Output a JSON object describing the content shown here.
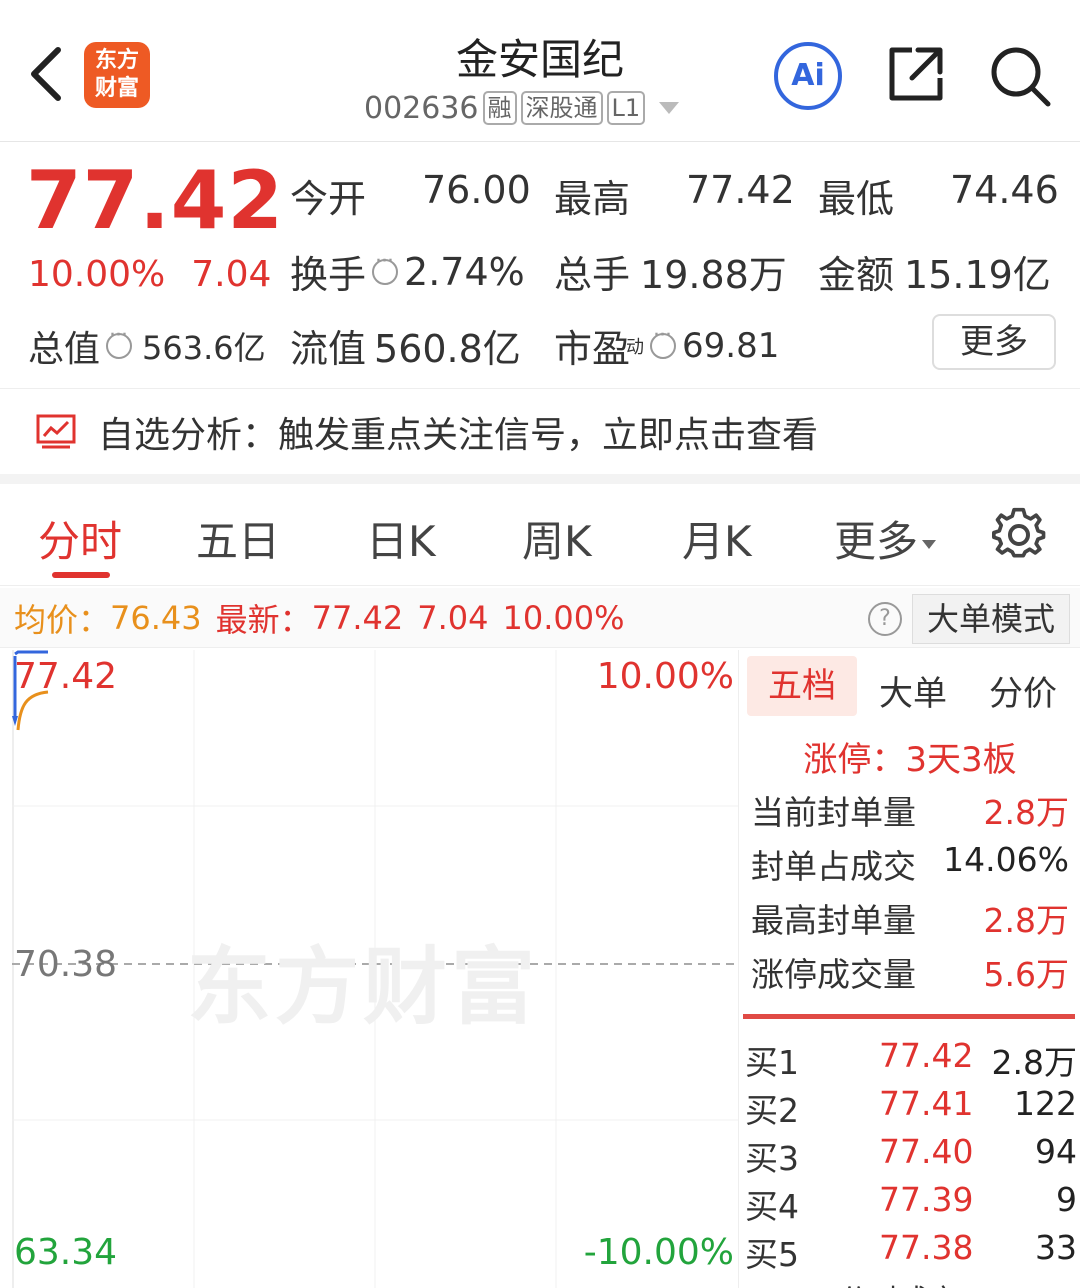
{
  "header": {
    "stock_name": "金安国纪",
    "stock_code": "002636",
    "tags": [
      "融",
      "深股通",
      "L1"
    ],
    "logo_text_line1": "东方",
    "logo_text_line2": "财富",
    "ai_label": "Ai"
  },
  "quote": {
    "price": "77.42",
    "change_pct": "10.00%",
    "change_amt": "7.04",
    "total_value_label": "总值",
    "total_value": "563.6亿",
    "open_label": "今开",
    "open": "76.00",
    "high_label": "最高",
    "high": "77.42",
    "low_label": "最低",
    "low": "74.46",
    "turnover_label": "换手",
    "turnover": "2.74%",
    "volume_label": "总手",
    "volume": "19.88万",
    "amount_label": "金额",
    "amount": "15.19亿",
    "float_label": "流值",
    "float_value": "560.8亿",
    "pe_label": "市盈",
    "pe_sup": "动",
    "pe": "69.81",
    "more_label": "更多"
  },
  "banner": {
    "text": "自选分析：触发重点关注信号，立即点击查看"
  },
  "tabs": {
    "items": [
      "分时",
      "五日",
      "日K",
      "周K",
      "月K",
      "更多"
    ]
  },
  "strip": {
    "avg_label": "均价：",
    "avg": "76.43",
    "latest_label": "最新：",
    "latest": "77.42",
    "change_amt": "7.04",
    "change_pct": "10.00%",
    "help": "?",
    "mode_label": "大单模式"
  },
  "chart": {
    "y_top": "77.42",
    "y_mid": "70.38",
    "y_bottom": "63.34",
    "pct_top": "10.00%",
    "pct_bottom": "-10.00%",
    "watermark": "东方财富"
  },
  "panel": {
    "tabs": [
      "五档",
      "大单",
      "分价"
    ],
    "limit_title": "涨停：3天3板",
    "stats": [
      {
        "label": "当前封单量",
        "value": "2.8万"
      },
      {
        "label": "封单占成交",
        "value": "14.06%"
      },
      {
        "label": "最高封单量",
        "value": "2.8万"
      },
      {
        "label": "涨停成交量",
        "value": "5.6万"
      }
    ],
    "bids": [
      {
        "label": "买1",
        "price": "77.42",
        "qty": "2.8万"
      },
      {
        "label": "买2",
        "price": "77.41",
        "qty": "122"
      },
      {
        "label": "买3",
        "price": "77.40",
        "qty": "94"
      },
      {
        "label": "买4",
        "price": "77.39",
        "qty": "9"
      },
      {
        "label": "买5",
        "price": "77.38",
        "qty": "33"
      }
    ],
    "bottom_partial": "分时成交"
  },
  "colors": {
    "up": "#e0332f",
    "down": "#22a43c",
    "avg": "#e8901c",
    "brand": "#ee5a24",
    "ai": "#3366dd"
  }
}
